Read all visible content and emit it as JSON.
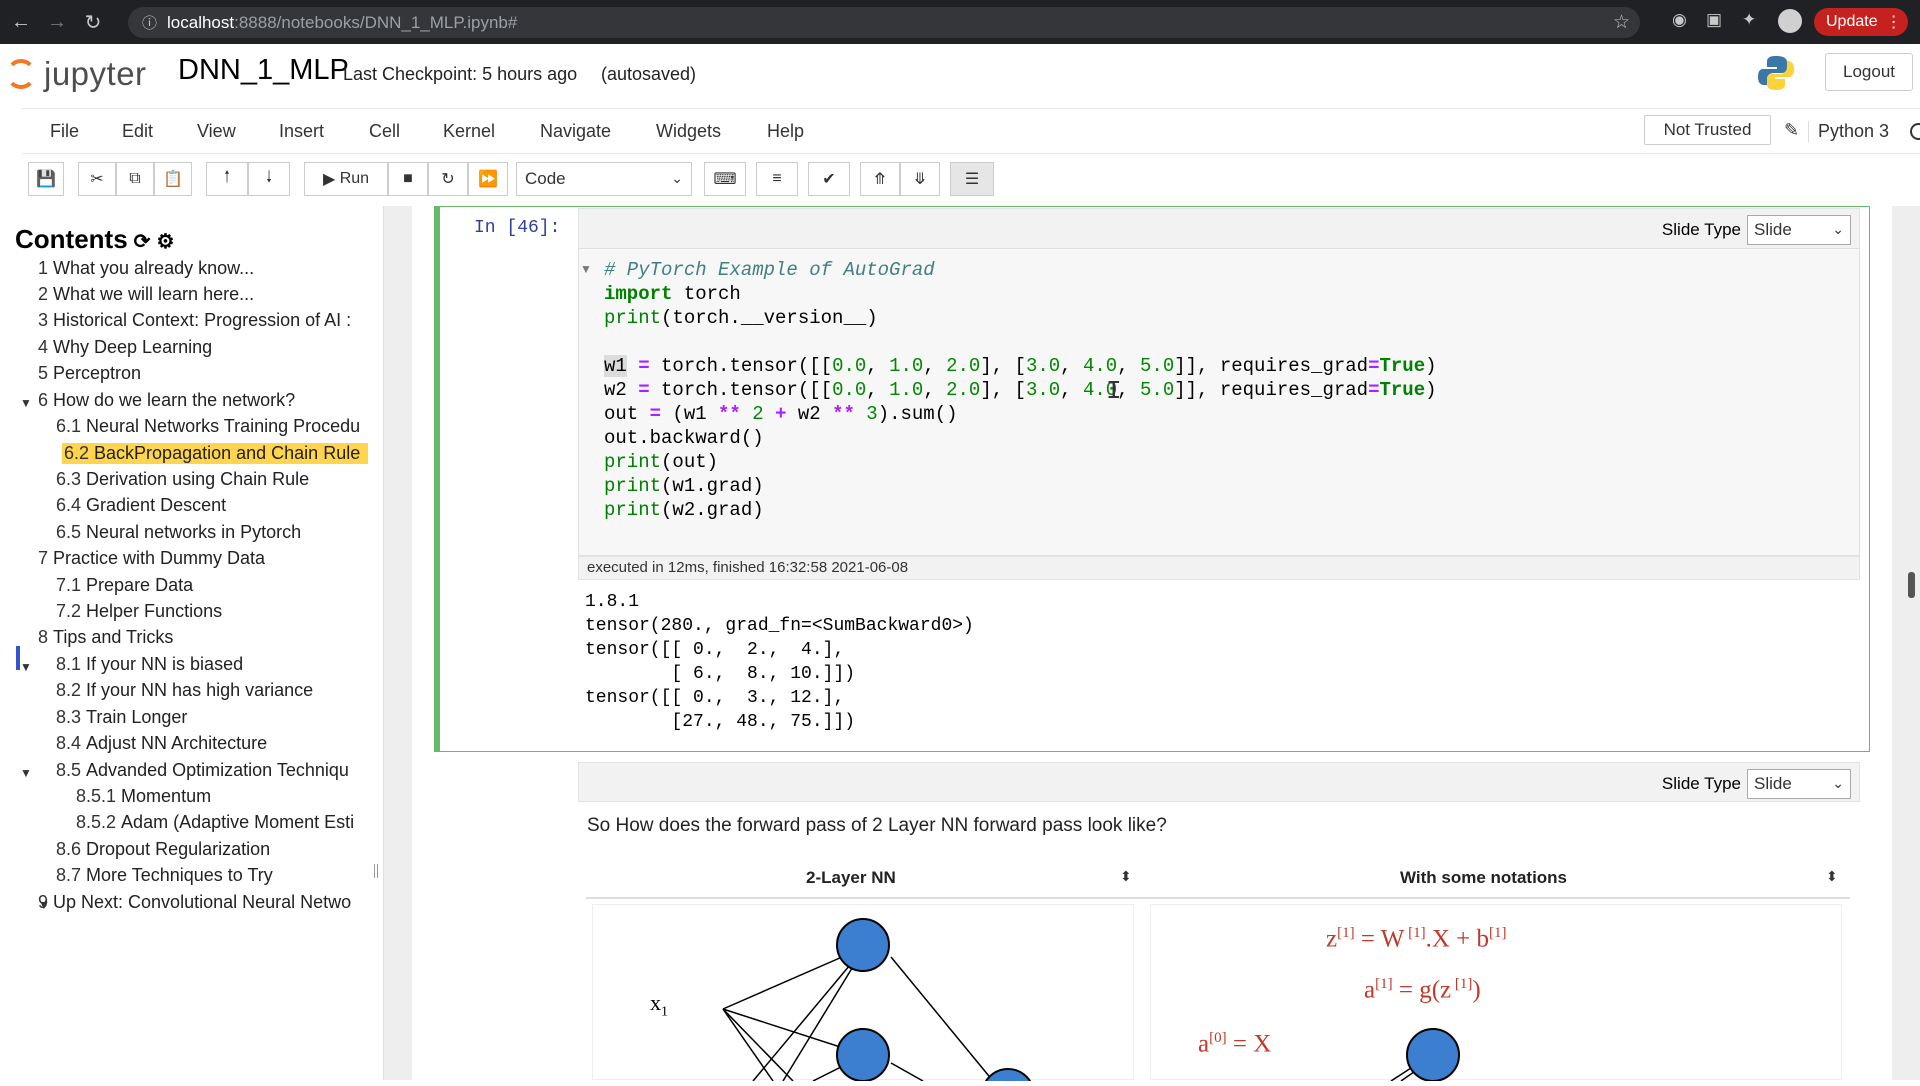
{
  "browser": {
    "url_host": "localhost",
    "url_path": ":8888/notebooks/DNN_1_MLP.ipynb#",
    "update_label": "Update"
  },
  "header": {
    "logo_text": "jupyter",
    "notebook_name": "DNN_1_MLP",
    "checkpoint": "Last Checkpoint: 5 hours ago",
    "autosaved": "(autosaved)",
    "logout": "Logout"
  },
  "menu": {
    "items": [
      "File",
      "Edit",
      "View",
      "Insert",
      "Cell",
      "Kernel",
      "Navigate",
      "Widgets",
      "Help"
    ],
    "not_trusted": "Not Trusted",
    "kernel": "Python 3"
  },
  "toolbar": {
    "run_label": "Run",
    "cell_type": "Code"
  },
  "toc": {
    "title": "Contents",
    "items": [
      {
        "num": "1",
        "label": "What you already know..."
      },
      {
        "num": "2",
        "label": "What we will learn here..."
      },
      {
        "num": "3",
        "label": "Historical Context: Progression of AI :"
      },
      {
        "num": "4",
        "label": "Why Deep Learning"
      },
      {
        "num": "5",
        "label": "Perceptron"
      },
      {
        "num": "6",
        "label": "How do we learn the network?"
      },
      {
        "num": "6.1",
        "label": "Neural Networks Training Procedu"
      },
      {
        "num": "6.2",
        "label": "BackPropagation and Chain Rule"
      },
      {
        "num": "6.3",
        "label": "Derivation using Chain Rule"
      },
      {
        "num": "6.4",
        "label": "Gradient Descent"
      },
      {
        "num": "6.5",
        "label": "Neural networks in Pytorch"
      },
      {
        "num": "7",
        "label": "Practice with Dummy Data"
      },
      {
        "num": "7.1",
        "label": "Prepare Data"
      },
      {
        "num": "7.2",
        "label": "Helper Functions"
      },
      {
        "num": "8",
        "label": "Tips and Tricks"
      },
      {
        "num": "8.1",
        "label": "If your NN is biased"
      },
      {
        "num": "8.2",
        "label": "If your NN has high variance"
      },
      {
        "num": "8.3",
        "label": "Train Longer"
      },
      {
        "num": "8.4",
        "label": "Adjust NN Architecture"
      },
      {
        "num": "8.5",
        "label": "Advanded Optimization Techniqu"
      },
      {
        "num": "8.5.1",
        "label": "Momentum"
      },
      {
        "num": "8.5.2",
        "label": "Adam (Adaptive Moment Esti"
      },
      {
        "num": "8.6",
        "label": "Dropout Regularization"
      },
      {
        "num": "8.7",
        "label": "More Techniques to Try"
      },
      {
        "num": "9",
        "label": "Up Next: Convolutional Neural Netwo"
      }
    ]
  },
  "code_cell": {
    "prompt": "In [46]:",
    "slide_type_label": "Slide Type",
    "slide_type_value": "Slide",
    "exec_info": "executed in 12ms, finished 16:32:58 2021-06-08",
    "output": "1.8.1\ntensor(280., grad_fn=<SumBackward0>)\ntensor([[ 0.,  2.,  4.],\n        [ 6.,  8., 10.]])\ntensor([[ 0.,  3., 12.],\n        [27., 48., 75.]])"
  },
  "md_cell": {
    "slide_type_label": "Slide Type",
    "slide_type_value": "Slide",
    "text": "So How does the forward pass of 2 Layer NN forward pass look like?",
    "left_header": "2-Layer NN",
    "right_header": "With some notations",
    "x_label": "x",
    "x_sub": "1"
  }
}
